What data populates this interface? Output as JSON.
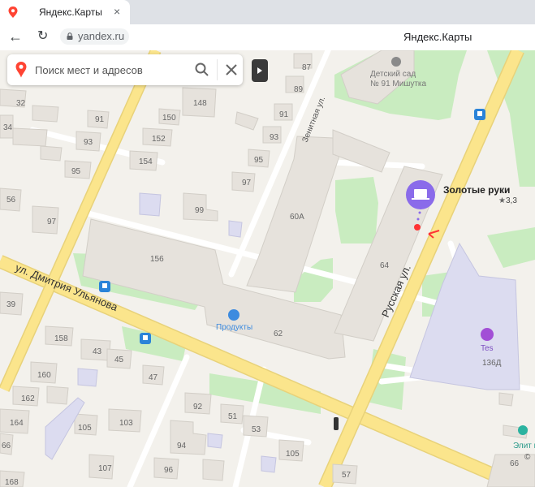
{
  "browser": {
    "tab_title": "Яндекс.Карты",
    "tab_close": "×",
    "back_icon": "←",
    "reload_icon": "↻",
    "url": "yandex.ru",
    "page_title": "Яндекс.Карты"
  },
  "search": {
    "placeholder": "Поиск мест и адресов"
  },
  "colors": {
    "accent_pin": "#ff4433",
    "poi_purple": "#8a6bea",
    "road_yellow": "#fbe58c",
    "park_green": "#c9ecc0"
  },
  "streets": {
    "dmitriya_ulyanova": "ул. Дмитрия Ульянова",
    "russkaya": "Русская ул.",
    "zenitnaya": "Зенитная ул."
  },
  "pois": {
    "kindergarten_line1": "Детский сад",
    "kindergarten_line2": "№ 91 Мишутка",
    "zolotye_ruki": "Золотые руки",
    "zolotye_rating": "3,3",
    "produkty": "Продукты",
    "tes": "Tes",
    "elit": "Элит м"
  },
  "copyright": "©",
  "houses": {
    "h87": "87",
    "h89": "89",
    "h91a": "91",
    "h93a": "93",
    "h148": "148",
    "h32": "32",
    "h34": "34",
    "h91b": "91",
    "h150": "150",
    "h152": "152",
    "h93b": "93",
    "h95a": "95",
    "h154": "154",
    "h95b": "95",
    "h97a": "97",
    "h56": "56",
    "h97b": "97",
    "h99": "99",
    "h60a": "60А",
    "h156": "156",
    "h64": "64",
    "h62": "62",
    "h39": "39",
    "h158": "158",
    "h43": "43",
    "h45": "45",
    "h160": "160",
    "h47": "47",
    "h162": "162",
    "h164": "164",
    "h92": "92",
    "h51": "51",
    "h53": "53",
    "h105a": "105",
    "h103": "103",
    "h94": "94",
    "h66a": "66",
    "h105b": "105",
    "h107": "107",
    "h96": "96",
    "h168": "168",
    "h57": "57",
    "h66b": "66",
    "h136d": "136Д"
  }
}
